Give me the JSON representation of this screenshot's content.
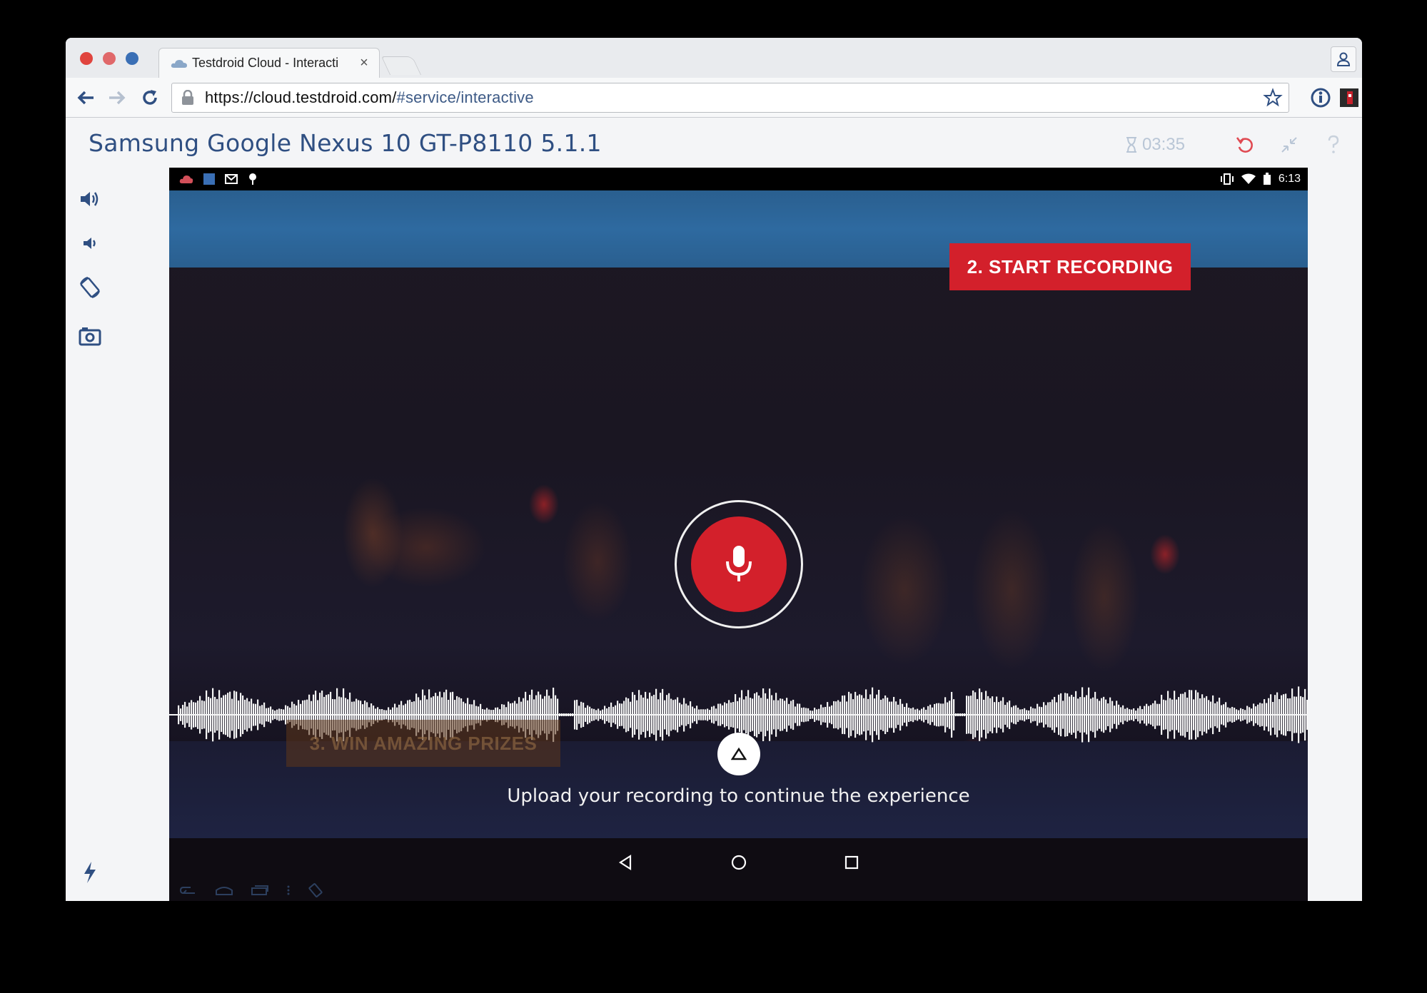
{
  "browser": {
    "tab_title": "Testdroid Cloud - Interacti",
    "tab_close": "×",
    "url_host": "https://cloud.testdroid.com/",
    "url_path": "#service/interactive"
  },
  "page": {
    "device_title": "Samsung Google Nexus 10 GT-P8110 5.1.1",
    "timer": "03:35"
  },
  "device": {
    "clock": "6:13",
    "start_badge": "2. START RECORDING",
    "win_badge": "3. WIN AMAZING PRIZES",
    "upload_text": "Upload your recording to continue the experience"
  },
  "colors": {
    "accent_red": "#d3202b",
    "title_blue": "#2f4f82",
    "app_blue": "#2e6aa0"
  }
}
